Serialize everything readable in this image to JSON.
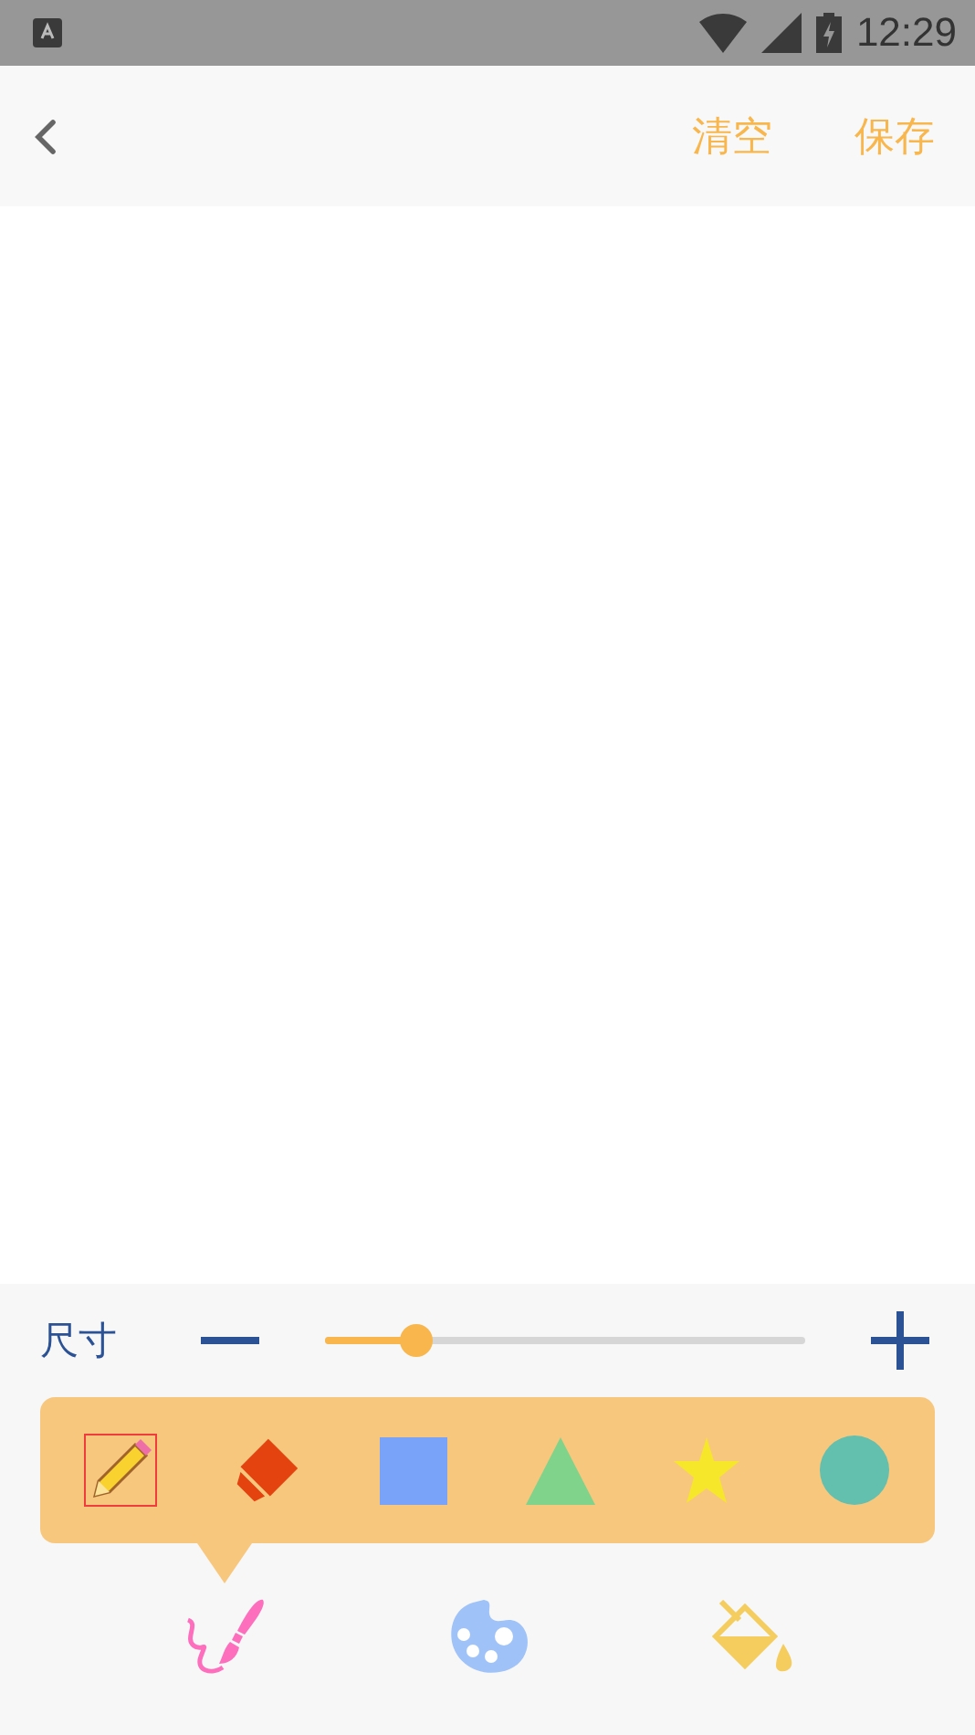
{
  "status_bar": {
    "time": "12:29"
  },
  "toolbar": {
    "actions": [
      "清空",
      "保存"
    ]
  },
  "size_control": {
    "label": "尺寸",
    "level": 0.19
  },
  "tools": [
    {
      "kind": "pencil",
      "selected": true
    },
    {
      "kind": "eraser",
      "selected": false
    },
    {
      "kind": "square",
      "selected": false
    },
    {
      "kind": "triangle",
      "selected": false
    },
    {
      "kind": "star",
      "selected": false
    },
    {
      "kind": "circle",
      "selected": false
    }
  ],
  "bottom_tabs": [
    {
      "kind": "brush",
      "selected": true
    },
    {
      "kind": "palette",
      "selected": false
    },
    {
      "kind": "bucket",
      "selected": false
    }
  ]
}
